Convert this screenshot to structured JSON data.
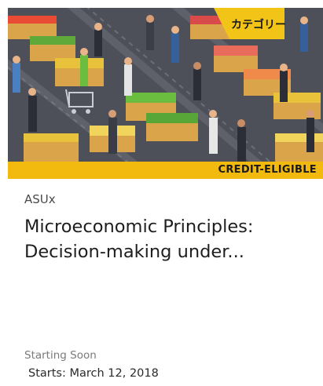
{
  "course_card": {
    "badge": "CREDIT-ELIGIBLE",
    "organization": "ASUx",
    "title": "Microeconomic Principles: Decision-making under...",
    "status": "Starting Soon",
    "start_date": "Starts: March 12, 2018",
    "accent_color": "#f2b90f",
    "image_sign_text": "カテゴリー"
  }
}
